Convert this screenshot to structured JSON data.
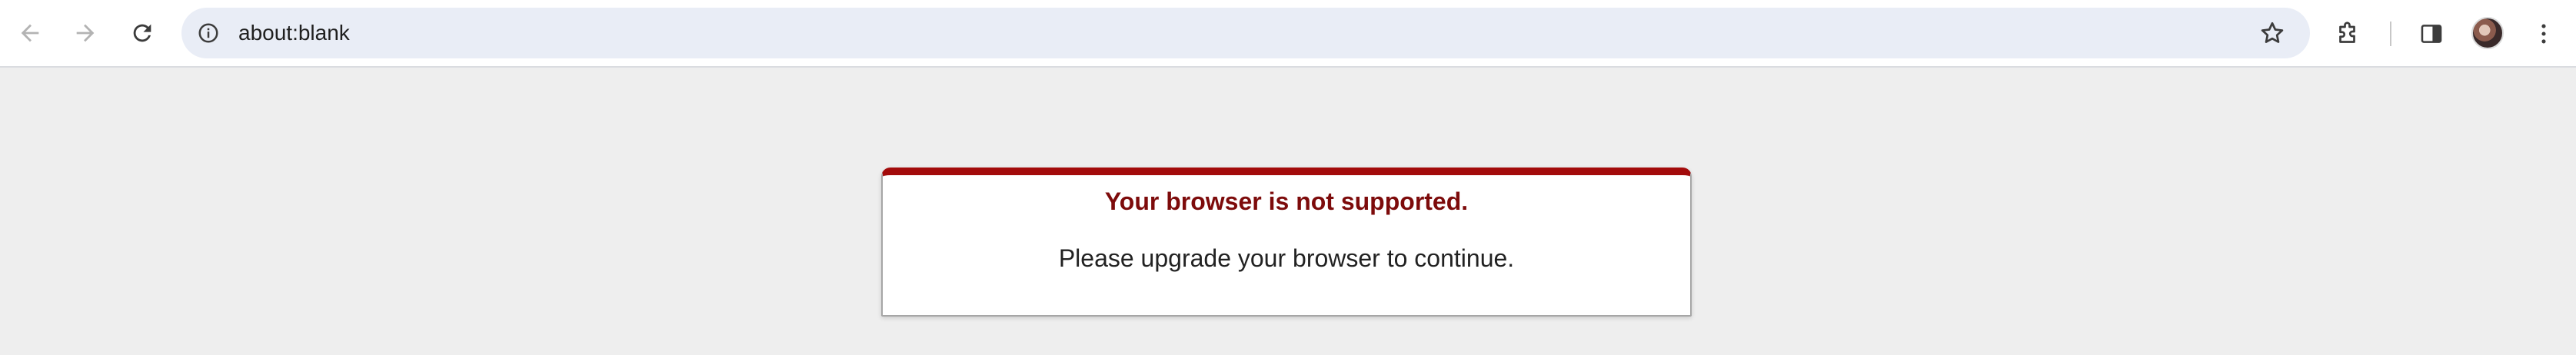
{
  "browser": {
    "address_bar": {
      "url": "about:blank"
    },
    "toolbar_icons": [
      "back-icon",
      "forward-icon",
      "reload-icon",
      "site-info-icon",
      "bookmark-star-icon",
      "extensions-icon",
      "side-panel-icon",
      "profile-avatar",
      "menu-icon"
    ]
  },
  "page": {
    "error_title": "Your browser is not supported.",
    "error_message": "Please upgrade your browser to continue.",
    "accent_color": "#a30b0b",
    "background_color": "#eeeeee"
  }
}
